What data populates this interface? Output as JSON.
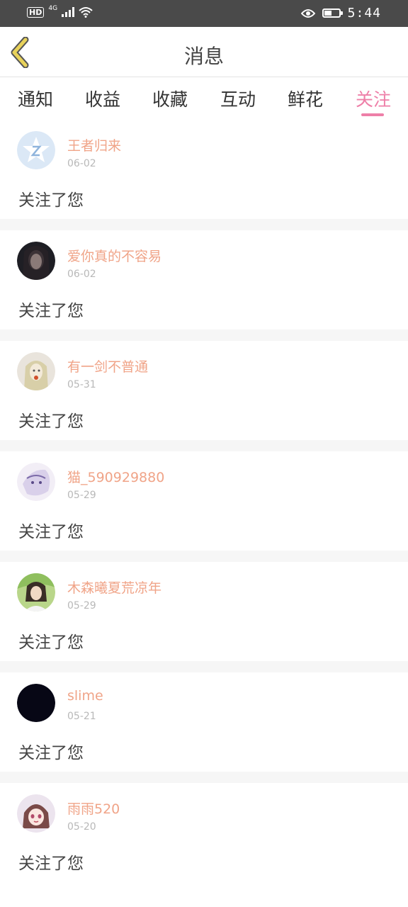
{
  "status_bar": {
    "hd": "HD",
    "network": "4G",
    "time": "5:44",
    "battery_level": 0.45
  },
  "header": {
    "title": "消息",
    "back_icon": "chevron-left-icon",
    "back_color": "#e8d25a"
  },
  "tabs": [
    {
      "label": "通知",
      "active": false
    },
    {
      "label": "收益",
      "active": false
    },
    {
      "label": "收藏",
      "active": false
    },
    {
      "label": "互动",
      "active": false
    },
    {
      "label": "鲜花",
      "active": false
    },
    {
      "label": "关注",
      "active": true
    }
  ],
  "colors": {
    "accent": "#ee7fa8",
    "name": "#f0a488",
    "date": "#b8b8b8",
    "divider": "#f6f6f6"
  },
  "notifications": [
    {
      "name": "王者归来",
      "date": "06-02",
      "message": "关注了您",
      "avatar": "default-avatar-icon"
    },
    {
      "name": "爱你真的不容易",
      "date": "06-02",
      "message": "关注了您",
      "avatar": "user-photo"
    },
    {
      "name": "有一剑不普通",
      "date": "05-31",
      "message": "关注了您",
      "avatar": "user-photo"
    },
    {
      "name": "猫_590929880",
      "date": "05-29",
      "message": "关注了您",
      "avatar": "user-photo"
    },
    {
      "name": "木森曦夏荒凉年",
      "date": "05-29",
      "message": "关注了您",
      "avatar": "user-photo"
    },
    {
      "name": "slime",
      "date": "05-21",
      "message": "关注了您",
      "avatar": "user-photo"
    },
    {
      "name": "雨雨520",
      "date": "05-20",
      "message": "关注了您",
      "avatar": "user-photo"
    }
  ]
}
